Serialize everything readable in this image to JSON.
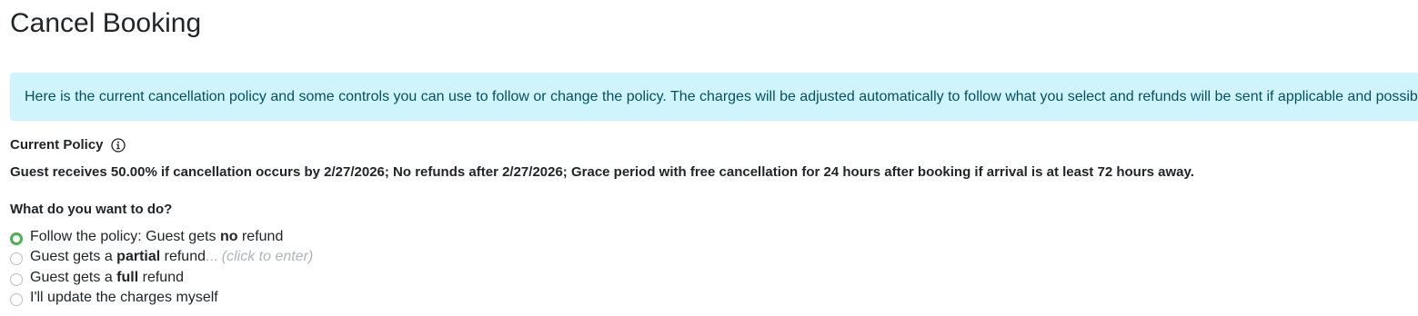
{
  "page": {
    "title": "Cancel Booking"
  },
  "alert": {
    "text": "Here is the current cancellation policy and some controls you can use to follow or change the policy. The charges will be adjusted automatically to follow what you select and refunds will be sent if applicable and possible.",
    "background_color": "#cff4fc",
    "text_color": "#055160"
  },
  "current_policy": {
    "label": "Current Policy",
    "info_icon": "info-circle-icon",
    "text": "Guest receives 50.00% if cancellation occurs by 2/27/2026; No refunds after 2/27/2026; Grace period with free cancellation for 24 hours after booking if arrival is at least 72 hours away."
  },
  "options": {
    "question": "What do you want to do?",
    "selected_index": 0,
    "accent_color": "#4caf50",
    "items": [
      {
        "prefix": "Follow the policy: Guest gets ",
        "emphasis": "no",
        "suffix": " refund",
        "hint": ""
      },
      {
        "prefix": "Guest gets a ",
        "emphasis": "partial",
        "suffix": " refund",
        "ellipsis": "...",
        "hint": "(click to enter)"
      },
      {
        "prefix": "Guest gets a ",
        "emphasis": "full",
        "suffix": " refund",
        "hint": ""
      },
      {
        "prefix": "I'll update the charges myself",
        "emphasis": "",
        "suffix": "",
        "hint": ""
      }
    ]
  }
}
